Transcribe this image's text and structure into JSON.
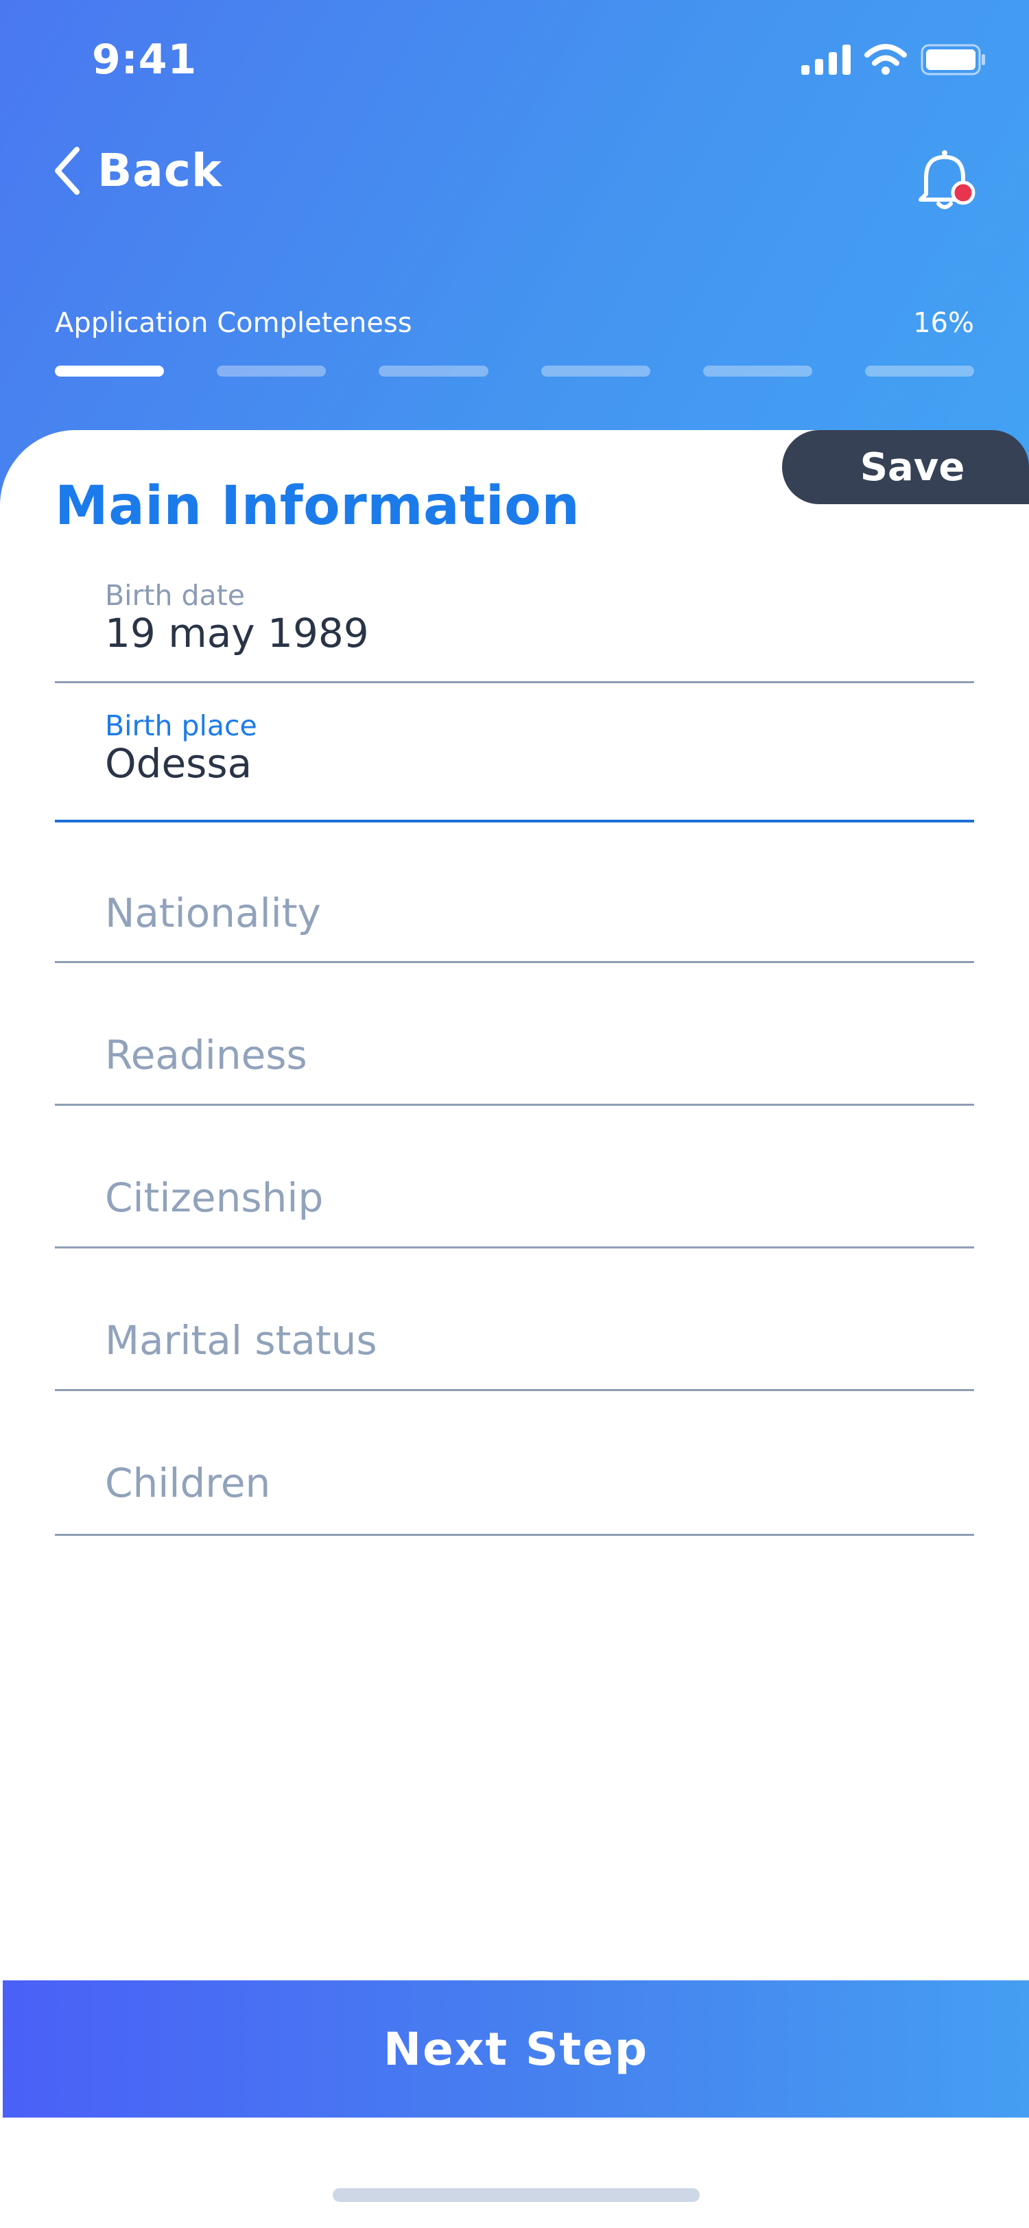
{
  "status_bar": {
    "time": "9:41"
  },
  "header": {
    "back_label": "Back",
    "progress_label": "Application Completeness",
    "progress_percent": "16%",
    "progress_fraction": 0.16,
    "segments_total": 6,
    "segments_done": 1
  },
  "card": {
    "save_label": "Save",
    "title": "Main Information",
    "fields": [
      {
        "label": "Birth date",
        "value": "19 may 1989"
      },
      {
        "label": "Birth place",
        "value": "Odessa"
      },
      {
        "placeholder": "Nationality"
      },
      {
        "placeholder": "Readiness"
      },
      {
        "placeholder": "Citizenship"
      },
      {
        "placeholder": "Marital status"
      },
      {
        "placeholder": "Children"
      }
    ]
  },
  "footer": {
    "next_label": "Next Step"
  },
  "colors": {
    "accent": "#1c7bea",
    "save_tab": "#364155",
    "notification_dot": "#e8344e"
  },
  "icons": {
    "back": "chevron-left-icon",
    "bell": "bell-icon",
    "signal": "signal-icon",
    "wifi": "wifi-icon",
    "battery": "battery-icon"
  }
}
